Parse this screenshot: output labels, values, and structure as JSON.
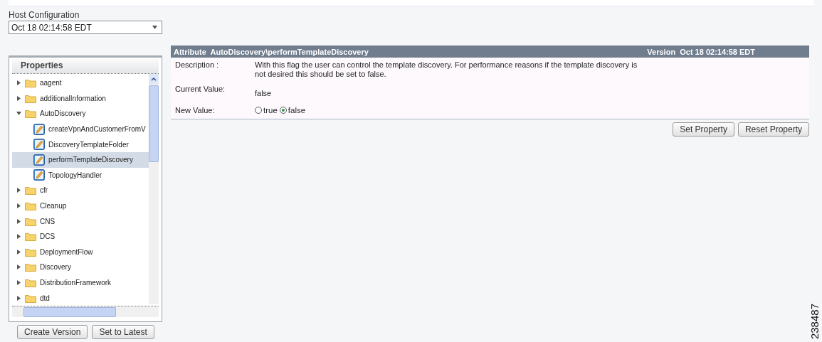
{
  "host_configuration": {
    "label": "Host Configuration",
    "value": "Oct 18 02:14:58 EDT"
  },
  "properties": {
    "title": "Properties",
    "tree": [
      {
        "label": "aagent",
        "kind": "folder",
        "expanded": false,
        "selected": false
      },
      {
        "label": "additionalInformation",
        "kind": "folder",
        "expanded": false,
        "selected": false
      },
      {
        "label": "AutoDiscovery",
        "kind": "folder",
        "expanded": true,
        "selected": false,
        "children": [
          {
            "label": "createVpnAndCustomerFromV",
            "kind": "property",
            "selected": false
          },
          {
            "label": "DiscoveryTemplateFolder",
            "kind": "property",
            "selected": false
          },
          {
            "label": "performTemplateDiscovery",
            "kind": "property",
            "selected": true
          },
          {
            "label": "TopologyHandler",
            "kind": "property",
            "selected": false
          }
        ]
      },
      {
        "label": "cfr",
        "kind": "folder",
        "expanded": false,
        "selected": false
      },
      {
        "label": "Cleanup",
        "kind": "folder",
        "expanded": false,
        "selected": false
      },
      {
        "label": "CNS",
        "kind": "folder",
        "expanded": false,
        "selected": false
      },
      {
        "label": "DCS",
        "kind": "folder",
        "expanded": false,
        "selected": false
      },
      {
        "label": "DeploymentFlow",
        "kind": "folder",
        "expanded": false,
        "selected": false
      },
      {
        "label": "Discovery",
        "kind": "folder",
        "expanded": false,
        "selected": false
      },
      {
        "label": "DistributionFramework",
        "kind": "folder",
        "expanded": false,
        "selected": false
      },
      {
        "label": "dtd",
        "kind": "folder",
        "expanded": false,
        "selected": false
      }
    ],
    "buttons": [
      "Create Version",
      "Set to Latest"
    ]
  },
  "attribute": {
    "title": "Attribute  AutoDiscovery\\performTemplateDiscovery",
    "version": "Version  Oct 18 02:14:58 EDT",
    "description_label": "Description :",
    "description": "With this flag the user can control the template discovery. For performance reasons if the template discovery is not desired this should be set to false.",
    "current_value_label": "Current Value:",
    "current_value": "false",
    "new_value_label": "New Value:",
    "options": [
      {
        "label": "true",
        "selected": false
      },
      {
        "label": "false",
        "selected": true
      }
    ],
    "buttons": [
      "Set Property",
      "Reset Property"
    ]
  },
  "figure_id": "238487"
}
